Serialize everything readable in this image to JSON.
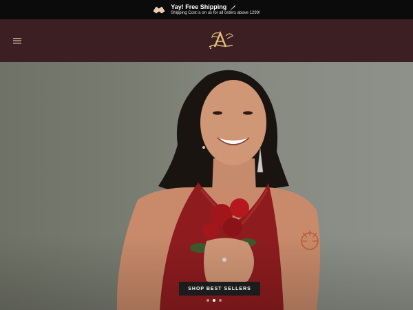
{
  "announcement": {
    "title": "Yay! Free Shipping",
    "subtitle": "Shipping Cost is on us for all orders above 1299!",
    "icon": "handshake-icon",
    "emoji_icon": "feather-icon"
  },
  "header": {
    "background": "#3c1f23",
    "logo_name": "brand-logo",
    "menu_icon": "hamburger-menu-icon",
    "actions": [
      "account-icon",
      "search-icon",
      "wishlist-heart-icon"
    ]
  },
  "hero": {
    "cta_label": "SHOP BEST SELLERS",
    "slides_count": 3,
    "active_slide": 2
  }
}
